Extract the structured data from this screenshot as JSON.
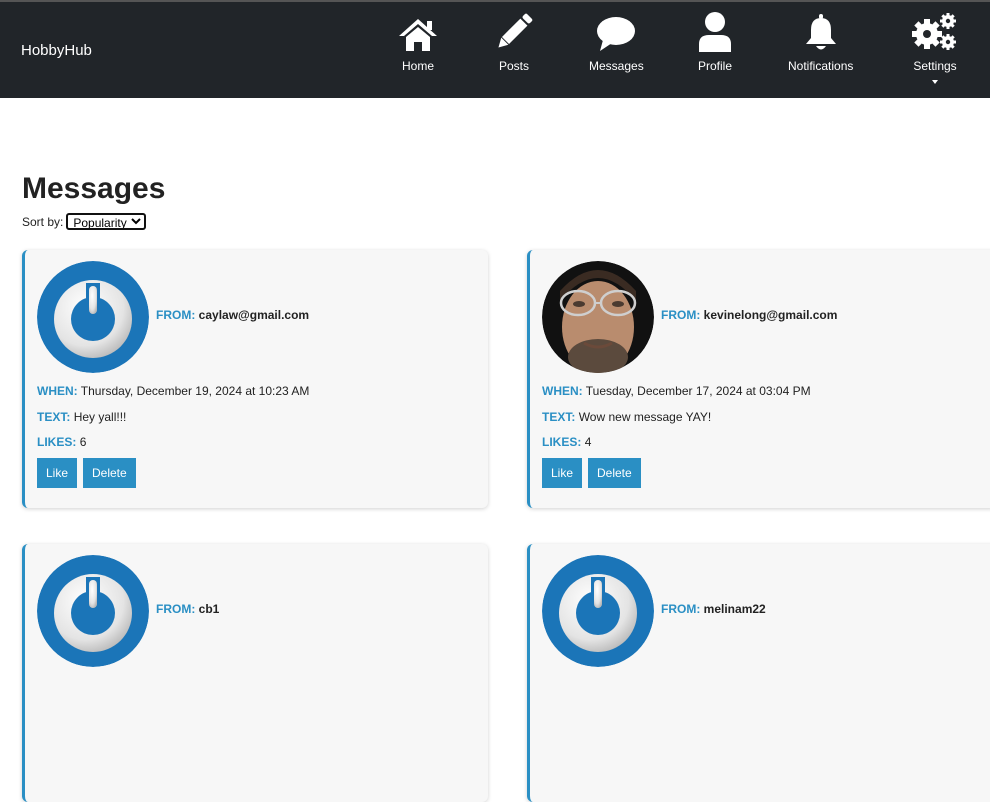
{
  "nav": {
    "brand": "HobbyHub",
    "items": [
      {
        "label": "Home",
        "icon": "home-icon"
      },
      {
        "label": "Posts",
        "icon": "pencil-icon"
      },
      {
        "label": "Messages",
        "icon": "chat-bubble-icon"
      },
      {
        "label": "Profile",
        "icon": "user-icon"
      },
      {
        "label": "Notifications",
        "icon": "bell-icon"
      },
      {
        "label": "Settings",
        "icon": "gears-icon"
      }
    ]
  },
  "page": {
    "title": "Messages",
    "sort_label": "Sort by:",
    "sort_value": "Popularity"
  },
  "messages": [
    {
      "from_label": "FROM:",
      "from": "caylaw@gmail.com",
      "when_label": "WHEN:",
      "when": "Thursday, December 19, 2024 at 10:23 AM",
      "text_label": "TEXT:",
      "text": "Hey yall!!!",
      "likes_label": "LIKES:",
      "likes": "6",
      "like_button": "Like",
      "delete_button": "Delete",
      "avatar": "default-power-avatar"
    },
    {
      "from_label": "FROM:",
      "from": "kevinelong@gmail.com",
      "when_label": "WHEN:",
      "when": "Tuesday, December 17, 2024 at 03:04 PM",
      "text_label": "TEXT:",
      "text": "Wow new message YAY!",
      "likes_label": "LIKES:",
      "likes": "4",
      "like_button": "Like",
      "delete_button": "Delete",
      "avatar": "user-photo-avatar"
    },
    {
      "from_label": "FROM:",
      "from": "cb1",
      "avatar": "default-power-avatar"
    },
    {
      "from_label": "FROM:",
      "from": "melinam22",
      "avatar": "default-power-avatar"
    }
  ],
  "colors": {
    "navbar": "#212529",
    "accent": "#2a8fc4",
    "card_bg": "#f7f7f7"
  }
}
